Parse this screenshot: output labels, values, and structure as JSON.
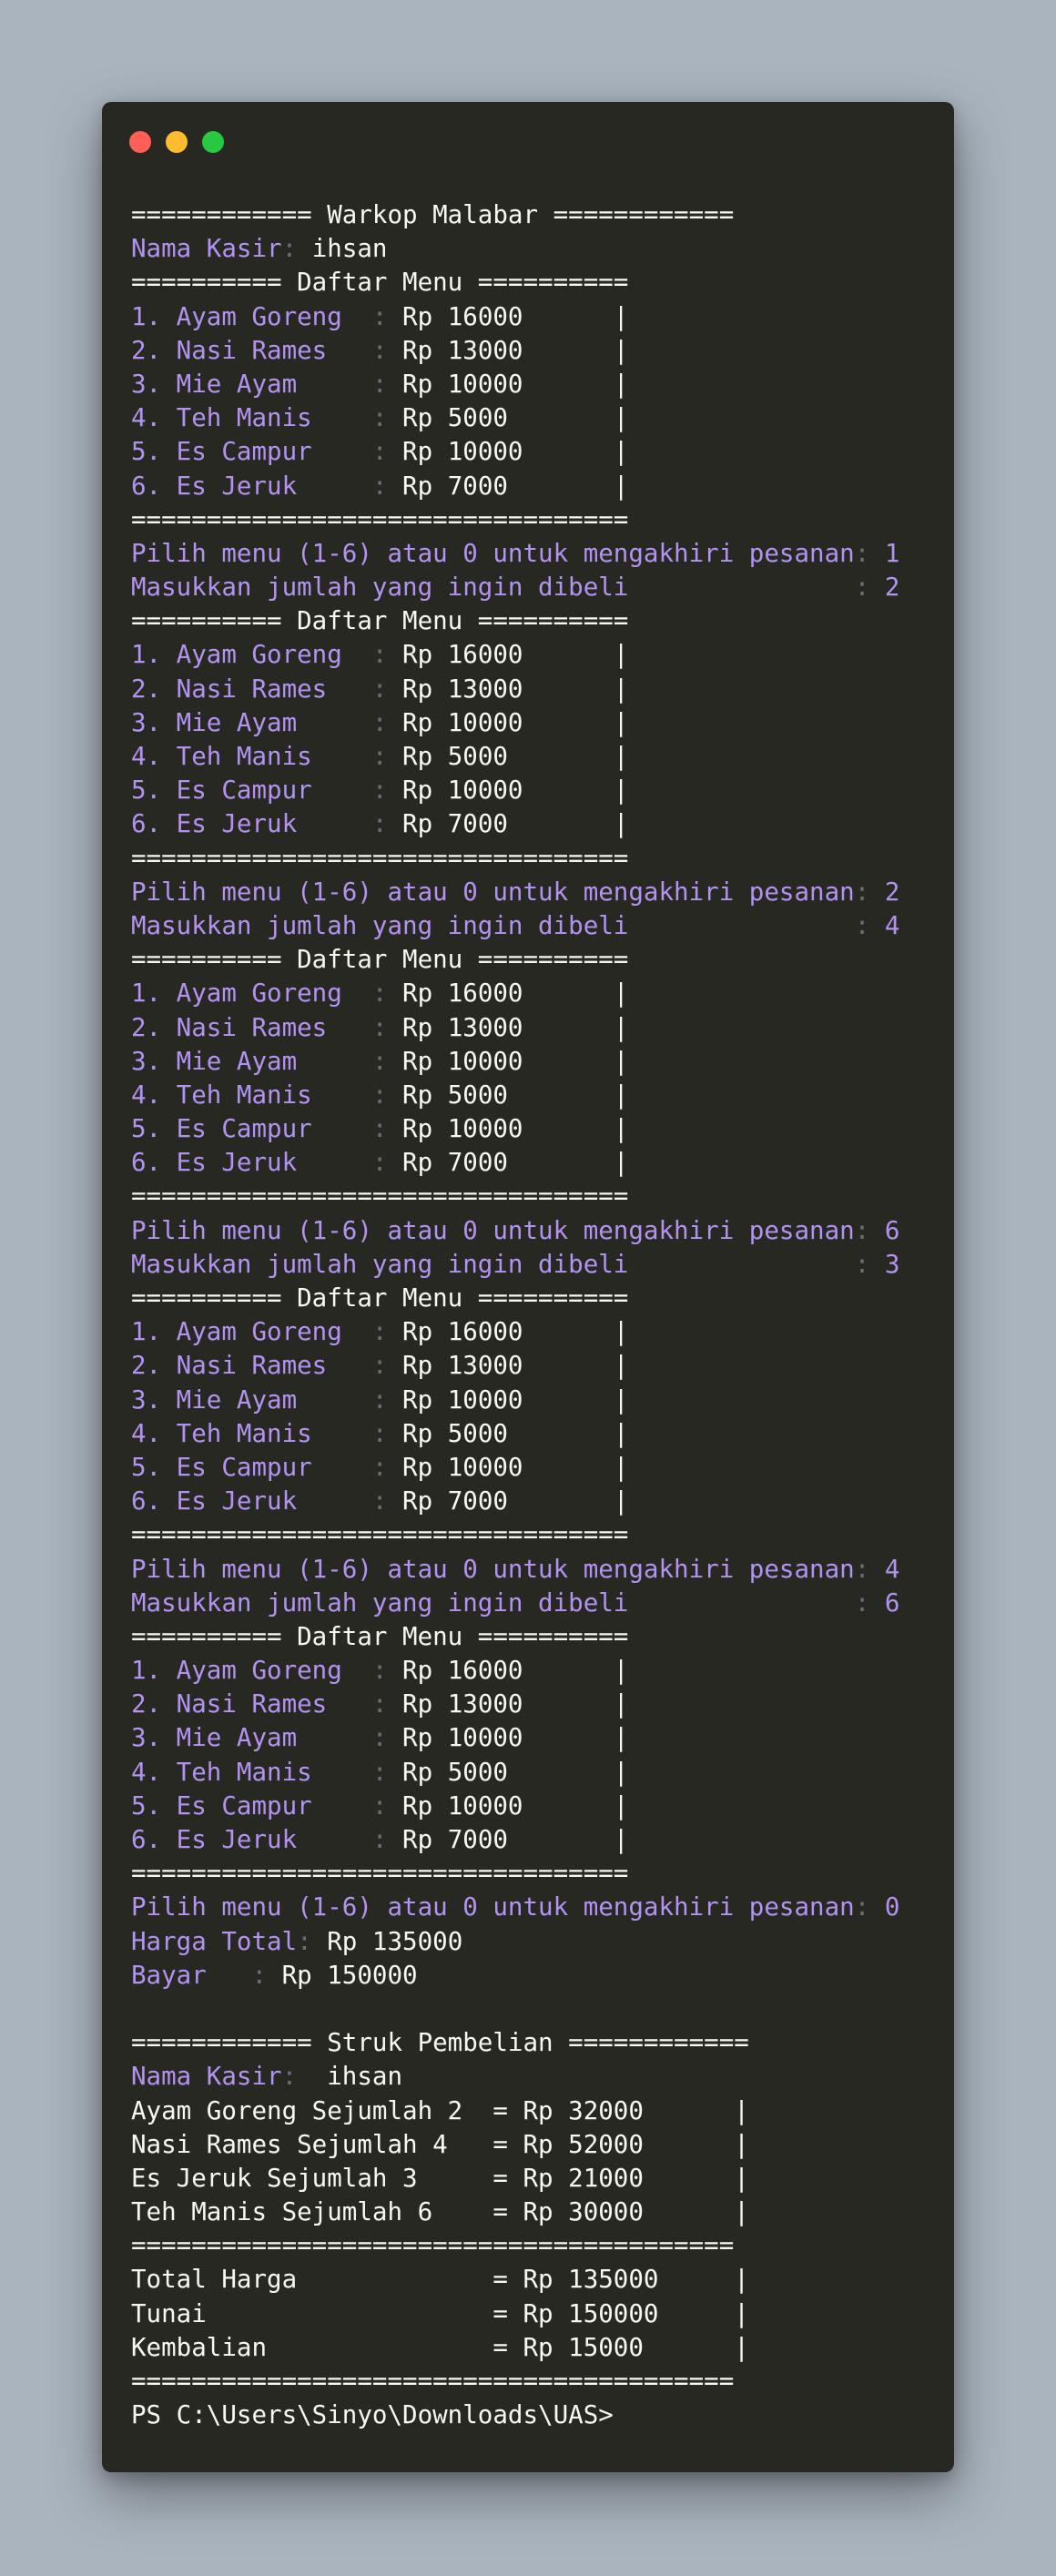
{
  "window": {
    "controls": [
      "close",
      "minimize",
      "maximize"
    ],
    "colors": {
      "close": "#ff5f57",
      "minimize": "#febc2e",
      "maximize": "#28c840"
    }
  },
  "terminal": {
    "colors": {
      "background": "#272822",
      "text": "#f8f8f2",
      "prompt_text": "#b392f0",
      "separator": "#6e6b78"
    },
    "lines": [
      {
        "segments": [
          {
            "t": "============ Warkop Malabar ============",
            "s": "w"
          }
        ]
      },
      {
        "segments": [
          {
            "t": "Nama Kasir",
            "s": "p"
          },
          {
            "t": ": ",
            "s": "c"
          },
          {
            "t": "ihsan",
            "s": "w"
          }
        ]
      },
      {
        "segments": [
          {
            "t": "========== Daftar Menu ==========",
            "s": "w"
          }
        ]
      },
      {
        "segments": [
          {
            "t": "1. Ayam Goreng  ",
            "s": "p"
          },
          {
            "t": ": ",
            "s": "c"
          },
          {
            "t": "Rp 16000      |",
            "s": "w"
          }
        ]
      },
      {
        "segments": [
          {
            "t": "2. Nasi Rames   ",
            "s": "p"
          },
          {
            "t": ": ",
            "s": "c"
          },
          {
            "t": "Rp 13000      |",
            "s": "w"
          }
        ]
      },
      {
        "segments": [
          {
            "t": "3. Mie Ayam     ",
            "s": "p"
          },
          {
            "t": ": ",
            "s": "c"
          },
          {
            "t": "Rp 10000      |",
            "s": "w"
          }
        ]
      },
      {
        "segments": [
          {
            "t": "4. Teh Manis    ",
            "s": "p"
          },
          {
            "t": ": ",
            "s": "c"
          },
          {
            "t": "Rp 5000       |",
            "s": "w"
          }
        ]
      },
      {
        "segments": [
          {
            "t": "5. Es Campur    ",
            "s": "p"
          },
          {
            "t": ": ",
            "s": "c"
          },
          {
            "t": "Rp 10000      |",
            "s": "w"
          }
        ]
      },
      {
        "segments": [
          {
            "t": "6. Es Jeruk     ",
            "s": "p"
          },
          {
            "t": ": ",
            "s": "c"
          },
          {
            "t": "Rp 7000       |",
            "s": "w"
          }
        ]
      },
      {
        "segments": [
          {
            "t": "=================================",
            "s": "w"
          }
        ]
      },
      {
        "segments": [
          {
            "t": "Pilih menu (1-6) atau 0 untuk mengakhiri pesanan",
            "s": "p"
          },
          {
            "t": ": ",
            "s": "c"
          },
          {
            "t": "1",
            "s": "p"
          }
        ]
      },
      {
        "segments": [
          {
            "t": "Masukkan jumlah yang ingin dibeli               ",
            "s": "p"
          },
          {
            "t": ": ",
            "s": "c"
          },
          {
            "t": "2",
            "s": "p"
          }
        ]
      },
      {
        "segments": [
          {
            "t": "========== Daftar Menu ==========",
            "s": "w"
          }
        ]
      },
      {
        "segments": [
          {
            "t": "1. Ayam Goreng  ",
            "s": "p"
          },
          {
            "t": ": ",
            "s": "c"
          },
          {
            "t": "Rp 16000      |",
            "s": "w"
          }
        ]
      },
      {
        "segments": [
          {
            "t": "2. Nasi Rames   ",
            "s": "p"
          },
          {
            "t": ": ",
            "s": "c"
          },
          {
            "t": "Rp 13000      |",
            "s": "w"
          }
        ]
      },
      {
        "segments": [
          {
            "t": "3. Mie Ayam     ",
            "s": "p"
          },
          {
            "t": ": ",
            "s": "c"
          },
          {
            "t": "Rp 10000      |",
            "s": "w"
          }
        ]
      },
      {
        "segments": [
          {
            "t": "4. Teh Manis    ",
            "s": "p"
          },
          {
            "t": ": ",
            "s": "c"
          },
          {
            "t": "Rp 5000       |",
            "s": "w"
          }
        ]
      },
      {
        "segments": [
          {
            "t": "5. Es Campur    ",
            "s": "p"
          },
          {
            "t": ": ",
            "s": "c"
          },
          {
            "t": "Rp 10000      |",
            "s": "w"
          }
        ]
      },
      {
        "segments": [
          {
            "t": "6. Es Jeruk     ",
            "s": "p"
          },
          {
            "t": ": ",
            "s": "c"
          },
          {
            "t": "Rp 7000       |",
            "s": "w"
          }
        ]
      },
      {
        "segments": [
          {
            "t": "=================================",
            "s": "w"
          }
        ]
      },
      {
        "segments": [
          {
            "t": "Pilih menu (1-6) atau 0 untuk mengakhiri pesanan",
            "s": "p"
          },
          {
            "t": ": ",
            "s": "c"
          },
          {
            "t": "2",
            "s": "p"
          }
        ]
      },
      {
        "segments": [
          {
            "t": "Masukkan jumlah yang ingin dibeli               ",
            "s": "p"
          },
          {
            "t": ": ",
            "s": "c"
          },
          {
            "t": "4",
            "s": "p"
          }
        ]
      },
      {
        "segments": [
          {
            "t": "========== Daftar Menu ==========",
            "s": "w"
          }
        ]
      },
      {
        "segments": [
          {
            "t": "1. Ayam Goreng  ",
            "s": "p"
          },
          {
            "t": ": ",
            "s": "c"
          },
          {
            "t": "Rp 16000      |",
            "s": "w"
          }
        ]
      },
      {
        "segments": [
          {
            "t": "2. Nasi Rames   ",
            "s": "p"
          },
          {
            "t": ": ",
            "s": "c"
          },
          {
            "t": "Rp 13000      |",
            "s": "w"
          }
        ]
      },
      {
        "segments": [
          {
            "t": "3. Mie Ayam     ",
            "s": "p"
          },
          {
            "t": ": ",
            "s": "c"
          },
          {
            "t": "Rp 10000      |",
            "s": "w"
          }
        ]
      },
      {
        "segments": [
          {
            "t": "4. Teh Manis    ",
            "s": "p"
          },
          {
            "t": ": ",
            "s": "c"
          },
          {
            "t": "Rp 5000       |",
            "s": "w"
          }
        ]
      },
      {
        "segments": [
          {
            "t": "5. Es Campur    ",
            "s": "p"
          },
          {
            "t": ": ",
            "s": "c"
          },
          {
            "t": "Rp 10000      |",
            "s": "w"
          }
        ]
      },
      {
        "segments": [
          {
            "t": "6. Es Jeruk     ",
            "s": "p"
          },
          {
            "t": ": ",
            "s": "c"
          },
          {
            "t": "Rp 7000       |",
            "s": "w"
          }
        ]
      },
      {
        "segments": [
          {
            "t": "=================================",
            "s": "w"
          }
        ]
      },
      {
        "segments": [
          {
            "t": "Pilih menu (1-6) atau 0 untuk mengakhiri pesanan",
            "s": "p"
          },
          {
            "t": ": ",
            "s": "c"
          },
          {
            "t": "6",
            "s": "p"
          }
        ]
      },
      {
        "segments": [
          {
            "t": "Masukkan jumlah yang ingin dibeli               ",
            "s": "p"
          },
          {
            "t": ": ",
            "s": "c"
          },
          {
            "t": "3",
            "s": "p"
          }
        ]
      },
      {
        "segments": [
          {
            "t": "========== Daftar Menu ==========",
            "s": "w"
          }
        ]
      },
      {
        "segments": [
          {
            "t": "1. Ayam Goreng  ",
            "s": "p"
          },
          {
            "t": ": ",
            "s": "c"
          },
          {
            "t": "Rp 16000      |",
            "s": "w"
          }
        ]
      },
      {
        "segments": [
          {
            "t": "2. Nasi Rames   ",
            "s": "p"
          },
          {
            "t": ": ",
            "s": "c"
          },
          {
            "t": "Rp 13000      |",
            "s": "w"
          }
        ]
      },
      {
        "segments": [
          {
            "t": "3. Mie Ayam     ",
            "s": "p"
          },
          {
            "t": ": ",
            "s": "c"
          },
          {
            "t": "Rp 10000      |",
            "s": "w"
          }
        ]
      },
      {
        "segments": [
          {
            "t": "4. Teh Manis    ",
            "s": "p"
          },
          {
            "t": ": ",
            "s": "c"
          },
          {
            "t": "Rp 5000       |",
            "s": "w"
          }
        ]
      },
      {
        "segments": [
          {
            "t": "5. Es Campur    ",
            "s": "p"
          },
          {
            "t": ": ",
            "s": "c"
          },
          {
            "t": "Rp 10000      |",
            "s": "w"
          }
        ]
      },
      {
        "segments": [
          {
            "t": "6. Es Jeruk     ",
            "s": "p"
          },
          {
            "t": ": ",
            "s": "c"
          },
          {
            "t": "Rp 7000       |",
            "s": "w"
          }
        ]
      },
      {
        "segments": [
          {
            "t": "=================================",
            "s": "w"
          }
        ]
      },
      {
        "segments": [
          {
            "t": "Pilih menu (1-6) atau 0 untuk mengakhiri pesanan",
            "s": "p"
          },
          {
            "t": ": ",
            "s": "c"
          },
          {
            "t": "4",
            "s": "p"
          }
        ]
      },
      {
        "segments": [
          {
            "t": "Masukkan jumlah yang ingin dibeli               ",
            "s": "p"
          },
          {
            "t": ": ",
            "s": "c"
          },
          {
            "t": "6",
            "s": "p"
          }
        ]
      },
      {
        "segments": [
          {
            "t": "========== Daftar Menu ==========",
            "s": "w"
          }
        ]
      },
      {
        "segments": [
          {
            "t": "1. Ayam Goreng  ",
            "s": "p"
          },
          {
            "t": ": ",
            "s": "c"
          },
          {
            "t": "Rp 16000      |",
            "s": "w"
          }
        ]
      },
      {
        "segments": [
          {
            "t": "2. Nasi Rames   ",
            "s": "p"
          },
          {
            "t": ": ",
            "s": "c"
          },
          {
            "t": "Rp 13000      |",
            "s": "w"
          }
        ]
      },
      {
        "segments": [
          {
            "t": "3. Mie Ayam     ",
            "s": "p"
          },
          {
            "t": ": ",
            "s": "c"
          },
          {
            "t": "Rp 10000      |",
            "s": "w"
          }
        ]
      },
      {
        "segments": [
          {
            "t": "4. Teh Manis    ",
            "s": "p"
          },
          {
            "t": ": ",
            "s": "c"
          },
          {
            "t": "Rp 5000       |",
            "s": "w"
          }
        ]
      },
      {
        "segments": [
          {
            "t": "5. Es Campur    ",
            "s": "p"
          },
          {
            "t": ": ",
            "s": "c"
          },
          {
            "t": "Rp 10000      |",
            "s": "w"
          }
        ]
      },
      {
        "segments": [
          {
            "t": "6. Es Jeruk     ",
            "s": "p"
          },
          {
            "t": ": ",
            "s": "c"
          },
          {
            "t": "Rp 7000       |",
            "s": "w"
          }
        ]
      },
      {
        "segments": [
          {
            "t": "=================================",
            "s": "w"
          }
        ]
      },
      {
        "segments": [
          {
            "t": "Pilih menu (1-6) atau 0 untuk mengakhiri pesanan",
            "s": "p"
          },
          {
            "t": ": ",
            "s": "c"
          },
          {
            "t": "0",
            "s": "p"
          }
        ]
      },
      {
        "segments": [
          {
            "t": "Harga Total",
            "s": "p"
          },
          {
            "t": ": ",
            "s": "c"
          },
          {
            "t": "Rp 135000",
            "s": "w"
          }
        ]
      },
      {
        "segments": [
          {
            "t": "Bayar   ",
            "s": "p"
          },
          {
            "t": ": ",
            "s": "c"
          },
          {
            "t": "Rp 150000",
            "s": "w"
          }
        ]
      },
      {
        "segments": []
      },
      {
        "segments": [
          {
            "t": "============ Struk Pembelian ============",
            "s": "w"
          }
        ]
      },
      {
        "segments": [
          {
            "t": "Nama Kasir",
            "s": "p"
          },
          {
            "t": ":  ",
            "s": "c"
          },
          {
            "t": "ihsan",
            "s": "w"
          }
        ]
      },
      {
        "segments": [
          {
            "t": "Ayam Goreng Sejumlah 2  = Rp 32000      |",
            "s": "w"
          }
        ]
      },
      {
        "segments": [
          {
            "t": "Nasi Rames Sejumlah 4   = Rp 52000      |",
            "s": "w"
          }
        ]
      },
      {
        "segments": [
          {
            "t": "Es Jeruk Sejumlah 3     = Rp 21000      |",
            "s": "w"
          }
        ]
      },
      {
        "segments": [
          {
            "t": "Teh Manis Sejumlah 6    = Rp 30000      |",
            "s": "w"
          }
        ]
      },
      {
        "segments": [
          {
            "t": "========================================",
            "s": "w"
          }
        ]
      },
      {
        "segments": [
          {
            "t": "Total Harga             = Rp 135000     |",
            "s": "w"
          }
        ]
      },
      {
        "segments": [
          {
            "t": "Tunai                   = Rp 150000     |",
            "s": "w"
          }
        ]
      },
      {
        "segments": [
          {
            "t": "Kembalian               = Rp 15000      |",
            "s": "w"
          }
        ]
      },
      {
        "segments": [
          {
            "t": "========================================",
            "s": "w"
          }
        ]
      },
      {
        "segments": [
          {
            "t": "PS C:\\Users\\Sinyo\\Downloads\\UAS>",
            "s": "w"
          }
        ]
      }
    ]
  }
}
